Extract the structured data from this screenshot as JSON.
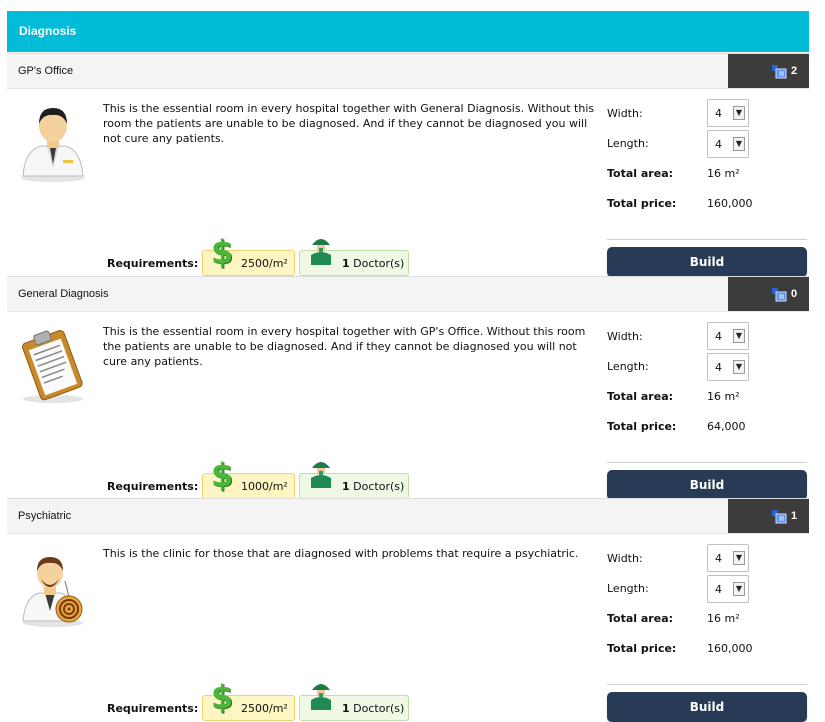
{
  "header": {
    "title": "Diagnosis"
  },
  "labels": {
    "width": "Width:",
    "length": "Length:",
    "total_area": "Total area:",
    "total_price": "Total price:",
    "requirements": "Requirements:",
    "build": "Build"
  },
  "rooms": [
    {
      "title": "GP's Office",
      "count": "2",
      "icon": "doctor-portrait-icon",
      "description": "This is the essential room in every hospital together with General Diagnosis. Without this room the patients are unable to be diagnosed. And if they cannot be diagnosed you will not cure any patients.",
      "width": "4",
      "length": "4",
      "total_area": "16 m²",
      "total_price": "160,000",
      "cost": "2500/m²",
      "staff_count": "1",
      "staff_role": "Doctor(s)"
    },
    {
      "title": "General Diagnosis",
      "count": "0",
      "icon": "clipboard-icon",
      "description": "This is the essential room in every hospital together with GP's Office. Without this room the patients are unable to be diagnosed. And if they cannot be diagnosed you will not cure any patients.",
      "width": "4",
      "length": "4",
      "total_area": "16 m²",
      "total_price": "64,000",
      "cost": "1000/m²",
      "staff_count": "1",
      "staff_role": "Doctor(s)"
    },
    {
      "title": "Psychiatric",
      "count": "1",
      "icon": "psychiatrist-hypnosis-icon",
      "description": "This is the clinic for those that are diagnosed with problems that require a psychiatric.",
      "width": "4",
      "length": "4",
      "total_area": "16 m²",
      "total_price": "160,000",
      "cost": "2500/m²",
      "staff_count": "1",
      "staff_role": "Doctor(s)"
    }
  ],
  "colors": {
    "header_bg": "#00bcd9",
    "count_bg": "#3c3c3c",
    "build_bg": "#273a56",
    "cost_bg": "#fdf6c2",
    "staff_bg": "#eef8e4"
  }
}
